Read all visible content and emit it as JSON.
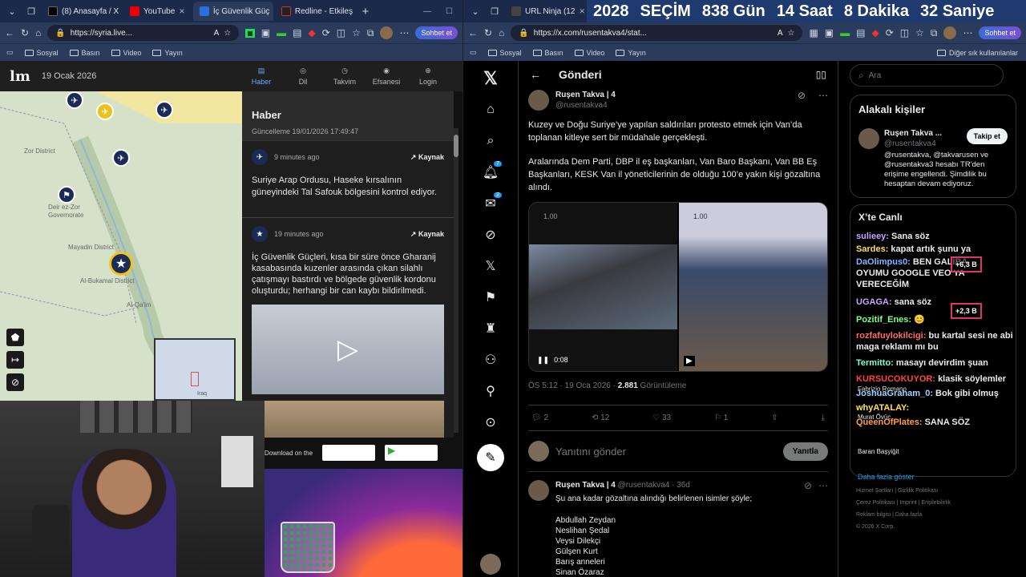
{
  "left_browser": {
    "tabs": [
      {
        "label": "(8) Anasayfa / X",
        "fav": "#000"
      },
      {
        "label": "YouTube",
        "fav": "#e00"
      },
      {
        "label": "İç Güvenlik Güç",
        "fav": "#2a6fdb"
      },
      {
        "label": "Redline - Etkileş",
        "fav": "#222"
      }
    ],
    "url": "https://syria.live...",
    "copilot": "Sohbet et",
    "bookmarks": [
      "Sosyal",
      "Basın",
      "Video",
      "Yayın"
    ]
  },
  "right_browser": {
    "tabs": [
      {
        "label": "URL Ninja (12",
        "fav": "#444"
      }
    ],
    "url": "https://x.com/rusentakva4/stat...",
    "copilot": "Sohbet et",
    "bookmarks": [
      "Sosyal",
      "Basın",
      "Video",
      "Yayın"
    ],
    "other_bookmarks": "Diğer sık kullanılanlar"
  },
  "countdown": {
    "year": "2028",
    "label": "SEÇİM",
    "days": "838",
    "days_label": "Gün",
    "hours": "14",
    "hours_label": "Saat",
    "minutes": "8",
    "minutes_label": "Dakika",
    "seconds": "32",
    "seconds_label": "Saniye"
  },
  "map_site": {
    "date": "19 Ocak 2026",
    "nav": [
      "Haber",
      "Dil",
      "Takvim",
      "Efsanesi",
      "Login"
    ],
    "map_labels": [
      "Zor District",
      "Deir ez-Zor Governorate",
      "Mayadin District",
      "Al-Bukamal District",
      "Al-Qa'im",
      "Iraq"
    ],
    "panel_title": "Haber",
    "updated": "Güncelleme 19/01/2026 17:49:47",
    "news": [
      {
        "time": "9 minutes ago",
        "source": "Kaynak",
        "text": "Suriye Arap Ordusu, Haseke kırsalının güneyindeki Tal Safouk bölgesini kontrol ediyor."
      },
      {
        "time": "19 minutes ago",
        "source": "Kaynak",
        "text": "İç Güvenlik Güçleri, kısa bir süre önce Gharanij kasabasında kuzenler arasında çıkan silahlı çatışmayı bastırdı ve bölgede güvenlik kordonu oluşturdu; herhangi bir can kaybı bildirilmedi."
      }
    ],
    "download": "Download on the"
  },
  "x_page": {
    "header": "Gönderi",
    "author": "Ruşen Takva | 4",
    "handle": "@rusentakva4",
    "para1": "Kuzey ve Doğu Suriye’ye yapılan saldırıları protesto etmek için Van’da toplanan kitleye sert bir müdahale gerçekleşti.",
    "para2": "Aralarında Dem Parti, DBP il eş başkanları, Van Baro Başkanı, Van BB Eş Başkanları, KESK Van il yöneticilerinin de olduğu 100’e yakın kişi gözaltına alındı.",
    "video1_time": "0:08",
    "video_speed": "1.00",
    "meta_time": "ÖS 5:12 · 19 Oca 2026 ·",
    "views": "2.881",
    "views_label": "Görüntüleme",
    "replies": "2",
    "reposts": "12",
    "likes": "33",
    "bookmarks": "1",
    "reply_placeholder": "Yanıtını gönder",
    "reply_button": "Yanıtla",
    "reply_author": "Ruşen Takva | 4",
    "reply_meta": "@rusentakva4 · 36d",
    "reply_text": "Şu ana kadar gözaltına alındığı belirlenen isimler şöyle;",
    "reply_names": [
      "Abdullah Zeydan",
      "Neslihan Şedal",
      "Veysi Dilekçi",
      "Gülşen Kurt",
      "Barış anneleri",
      "Sinan Özaraz"
    ],
    "badge_notifications": "7",
    "badge_messages": "2"
  },
  "x_right": {
    "search_placeholder": "Ara",
    "related_title": "Alakalı kişiler",
    "related_name": "Ruşen Takva ...",
    "related_handle": "@rusentakva4",
    "follow": "Takip et",
    "related_bio": "@rusentakva, @takvarusen ve @rusentakva3 hesabı TR'den erişime engellendi. Şimdilik bu hesaptan devam ediyoruz.",
    "live_title": "X’te Canlı",
    "footer": [
      "Hizmet Şartları",
      "Gizlilik Politikası",
      "Çerez Politikası",
      "Imprint",
      "Erişilebilirlik",
      "Reklam bilgisi",
      "Daha fazla",
      "© 2026 X Corp."
    ],
    "more": "Daha fazla göster",
    "trends": [
      "Fabrizio Romano",
      "Murat Övüç",
      "Baran Başyiğit"
    ]
  },
  "chat": [
    {
      "user": "sulieey:",
      "msg": "Sana söz",
      "color": "#c9a3ff"
    },
    {
      "user": "Sardes:",
      "msg": "kapat artık şunu ya",
      "color": "#ffd966"
    },
    {
      "user": "DaOlimpus0:",
      "msg": "BEN GALİBA OYUMU GOOGLE VEO YA VERECEĞİM",
      "color": "#7fb8ff"
    },
    {
      "user": "UGAGA:",
      "msg": "sana söz",
      "color": "#c9a3ff"
    },
    {
      "user": "Pozitif_Enes:",
      "msg": "😊",
      "color": "#7fff7f"
    },
    {
      "user": "rozfafuylokilcigi:",
      "msg": "bu kartal sesi ne abi maga reklamı mı bu",
      "color": "#ff6b6b"
    },
    {
      "user": "Termitto:",
      "msg": "masayı devirdim şuan",
      "color": "#7fffd4"
    },
    {
      "user": "KURSUCOKUYOR:",
      "msg": "klasik söylemler",
      "color": "#ff4444"
    },
    {
      "user": "JoshuaGraham_0:",
      "msg": "Bok gibi olmuş",
      "color": "#9fd4ff"
    },
    {
      "user": "whyATALAY:",
      "msg": "",
      "color": "#ffe14d"
    },
    {
      "user": "QueenOfPlates:",
      "msg": "SANA SÖZ",
      "color": "#ff9d4d"
    }
  ],
  "donations": [
    "+6,3 B",
    "+2,3 B"
  ]
}
